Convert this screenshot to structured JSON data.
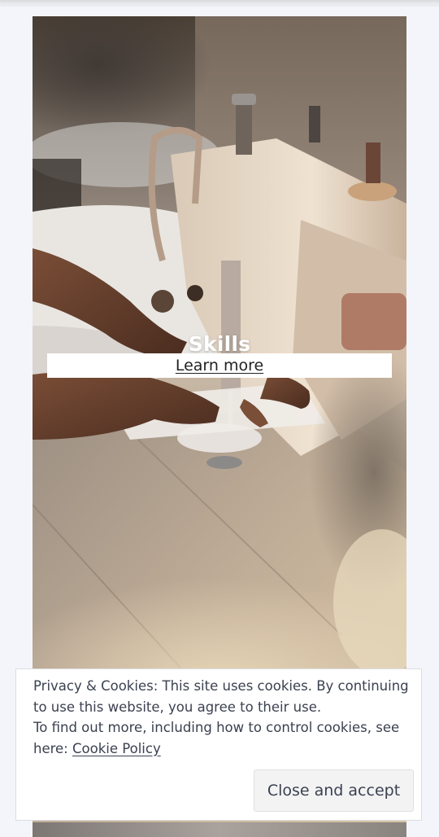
{
  "hero": {
    "image": "sewing-machine-photo",
    "title": "Skills",
    "button_label": "Learn more"
  },
  "cookie_banner": {
    "line1": "Privacy & Cookies: This site uses cookies. By continuing to use this website, you agree to their use.",
    "line2": "To find out more, including how to control cookies, see here:",
    "link_label": "Cookie Policy",
    "accept_label": "Close and accept"
  },
  "colors": {
    "page_background": "#f3f5fa",
    "text": "#3b4150",
    "button_background": "#f3f3f4"
  }
}
